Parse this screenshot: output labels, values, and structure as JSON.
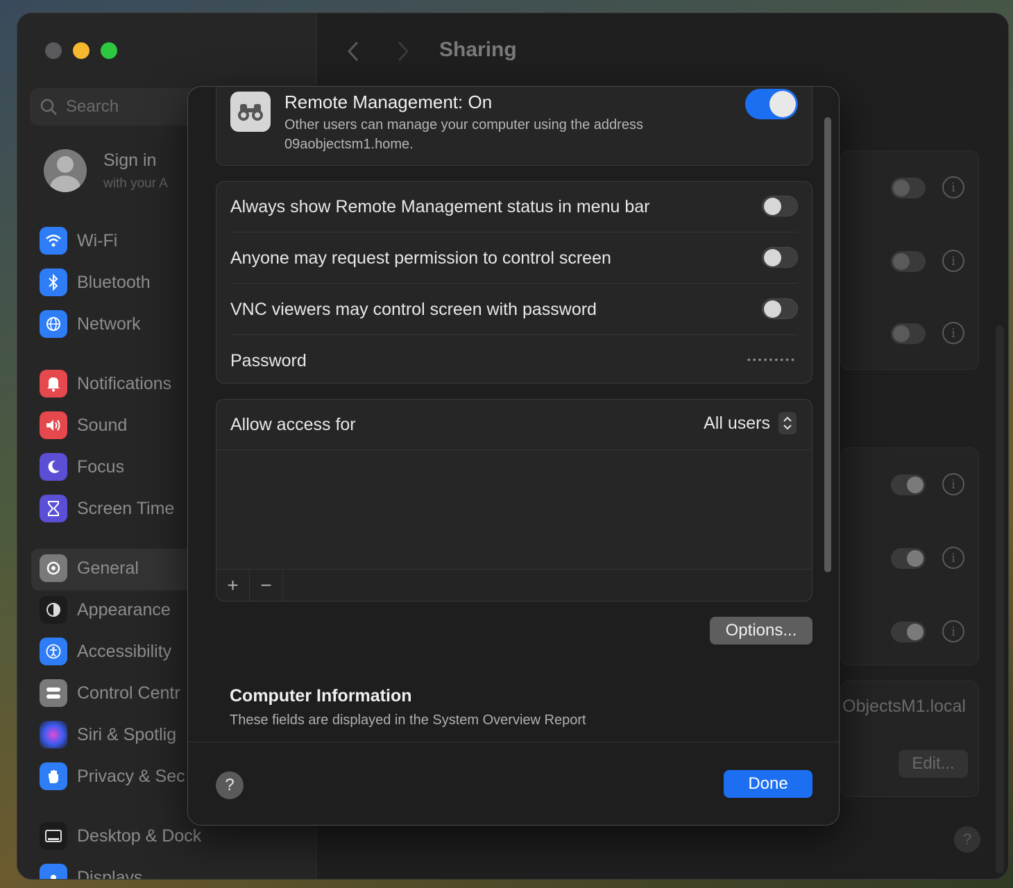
{
  "window": {
    "title": "Sharing"
  },
  "sidebar": {
    "search_placeholder": "Search",
    "account": {
      "title": "Sign in",
      "subtitle": "with your A"
    },
    "items": [
      {
        "label": "Wi-Fi",
        "icon": "wifi-icon",
        "color": "#2f7df6"
      },
      {
        "label": "Bluetooth",
        "icon": "bluetooth-icon",
        "color": "#2f7df6"
      },
      {
        "label": "Network",
        "icon": "globe-icon",
        "color": "#2f7df6"
      },
      {
        "label": "Notifications",
        "icon": "bell-icon",
        "color": "#e5484d"
      },
      {
        "label": "Sound",
        "icon": "speaker-icon",
        "color": "#e5484d"
      },
      {
        "label": "Focus",
        "icon": "moon-icon",
        "color": "#5b4fd6"
      },
      {
        "label": "Screen Time",
        "icon": "hourglass-icon",
        "color": "#5b4fd6"
      },
      {
        "label": "General",
        "icon": "gear-icon",
        "color": "#7a7a7a"
      },
      {
        "label": "Appearance",
        "icon": "appearance-icon",
        "color": "#1c1c1c"
      },
      {
        "label": "Accessibility",
        "icon": "accessibility-icon",
        "color": "#2f7df6"
      },
      {
        "label": "Control Centr",
        "icon": "control-center-icon",
        "color": "#7a7a7a"
      },
      {
        "label": "Siri & Spotlig",
        "icon": "siri-icon",
        "color": "#a24bd6"
      },
      {
        "label": "Privacy & Sec",
        "icon": "hand-icon",
        "color": "#2f7df6"
      },
      {
        "label": "Desktop & Dock",
        "icon": "dock-icon",
        "color": "#1c1c1c"
      },
      {
        "label": "Displays",
        "icon": "display-icon",
        "color": "#2f7df6"
      }
    ]
  },
  "background": {
    "hostname_partial": "ObjectsM1.local",
    "edit_label": "Edit...",
    "help_label": "?"
  },
  "modal": {
    "remote_management": {
      "title": "Remote Management: On",
      "subtitle": "Other users can manage your computer using the address 09aobjectsm1.home.",
      "enabled": true
    },
    "options": [
      {
        "label": "Always show Remote Management status in menu bar",
        "enabled": false
      },
      {
        "label": "Anyone may request permission to control screen",
        "enabled": false
      },
      {
        "label": "VNC viewers may control screen with password",
        "enabled": false
      }
    ],
    "password": {
      "label": "Password",
      "value": "•••••••••"
    },
    "access": {
      "label": "Allow access for",
      "value": "All users"
    },
    "list_controls": {
      "add": "+",
      "remove": "−"
    },
    "options_button": "Options...",
    "computer_info": {
      "title": "Computer Information",
      "subtitle": "These fields are displayed in the System Overview Report"
    },
    "help_button": "?",
    "done_button": "Done"
  }
}
